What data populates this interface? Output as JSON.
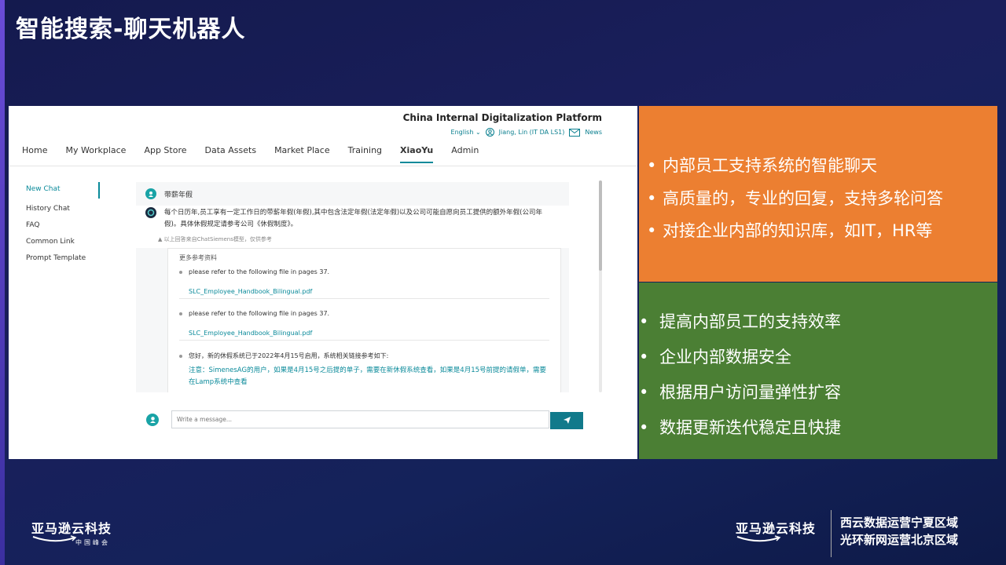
{
  "slide": {
    "title": "智能搜索-聊天机器人"
  },
  "app": {
    "platform_title": "China Internal Digitalization Platform",
    "language": "English",
    "user": "Jiang, Lin (IT DA LS1)",
    "news_label": "News",
    "nav": [
      "Home",
      "My Workplace",
      "App Store",
      "Data Assets",
      "Market Place",
      "Training",
      "XiaoYu",
      "Admin"
    ],
    "nav_active": "XiaoYu",
    "sidebar": [
      "New Chat",
      "History Chat",
      "FAQ",
      "Common Link",
      "Prompt Template"
    ],
    "question": "带薪年假",
    "answer": "每个日历年,员工享有一定工作日的带薪年假(年假),其中包含法定年假(法定年假)以及公司可能自愿向员工提供的额外年假(公司年假)。具体休假规定请参考公司《休假制度》。",
    "answer_note": "以上回答来自ChatSiemens模型，仅供参考",
    "refs_title": "更多参考资料",
    "refs": [
      {
        "text": "please refer to the following file in pages 37.",
        "file": "SLC_Employee_Handbook_Bilingual.pdf"
      },
      {
        "text": "please refer to the following file in pages 37.",
        "file": "SLC_Employee_Handbook_Bilingual.pdf"
      }
    ],
    "ref3_text": "您好，新的休假系统已于2022年4月15号启用，系统相关链接参考如下:",
    "ref3_note": "注意：SimenesAG的用户，如果是4月15号之后提的单子，需要在新休假系统查看，如果是4月15号前提的请假单，需要在Lamp系统中查看",
    "input_placeholder": "Write a message..."
  },
  "orange_panel": {
    "bullets": [
      "内部员工支持系统的智能聊天",
      "高质量的，专业的回复，支持多轮问答",
      "对接企业内部的知识库，如IT，HR等"
    ]
  },
  "green_panel": {
    "bullets": [
      "提高内部员工的支持效率",
      "企业内部数据安全",
      "根据用户访问量弹性扩容",
      "数据更新迭代稳定且快捷"
    ]
  },
  "footer": {
    "brand": "亚马逊云科技",
    "brand_sub": "中国峰会",
    "region1": "西云数据运营宁夏区域",
    "region2": "光环新网运营北京区域"
  },
  "colors": {
    "accent": "#0a8a9a",
    "orange": "#ec7f31",
    "green": "#4b7f34"
  }
}
